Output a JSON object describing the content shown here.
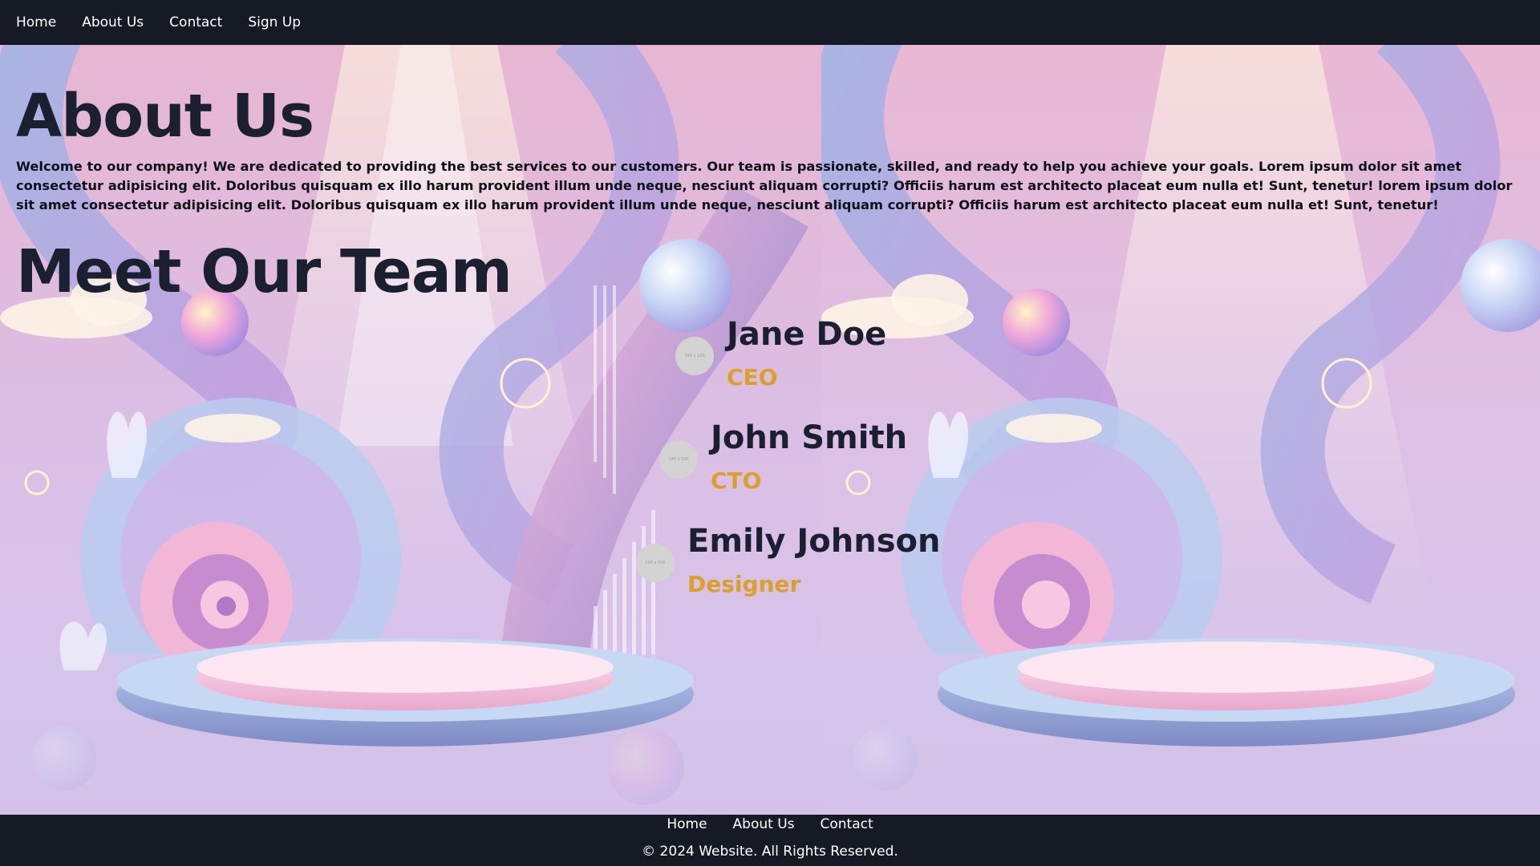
{
  "nav": {
    "items": [
      {
        "label": "Home"
      },
      {
        "label": "About Us"
      },
      {
        "label": "Contact"
      },
      {
        "label": "Sign Up"
      }
    ]
  },
  "about": {
    "title": "About Us",
    "text": "Welcome to our company! We are dedicated to providing the best services to our customers. Our team is passionate, skilled, and ready to help you achieve your goals. Lorem ipsum dolor sit amet consectetur adipisicing elit. Doloribus quisquam ex illo harum provident illum unde neque, nesciunt aliquam corrupti? Officiis harum est architecto placeat eum nulla et! Sunt, tenetur! lorem ipsum dolor sit amet consectetur adipisicing elit. Doloribus quisquam ex illo harum provident illum unde neque, nesciunt aliquam corrupti? Officiis harum est architecto placeat eum nulla et! Sunt, tenetur!"
  },
  "team": {
    "title": "Meet Our Team",
    "members": [
      {
        "name": "Jane Doe",
        "role": "CEO",
        "avatar_text": "100 x 100"
      },
      {
        "name": "John Smith",
        "role": "CTO",
        "avatar_text": "100 x 100"
      },
      {
        "name": "Emily Johnson",
        "role": "Designer",
        "avatar_text": "100 x 100"
      }
    ]
  },
  "footer": {
    "links": [
      {
        "label": "Home"
      },
      {
        "label": "About Us"
      },
      {
        "label": "Contact"
      }
    ],
    "copyright": "© 2024 Website. All Rights Reserved."
  },
  "colors": {
    "navbar_bg": "#161a25",
    "heading": "#1b2030",
    "role": "#d9a12a",
    "avatar": "#d3d3d3"
  }
}
